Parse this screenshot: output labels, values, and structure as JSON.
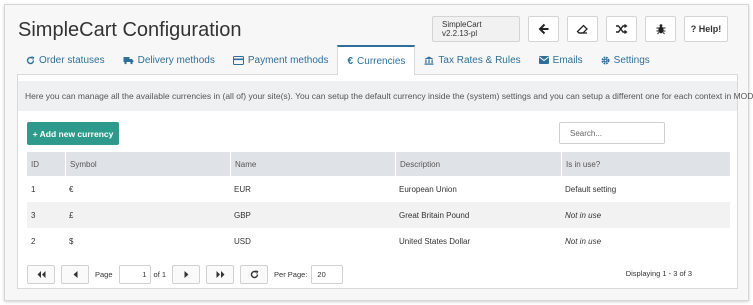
{
  "app": {
    "title": "SimpleCart Configuration"
  },
  "toolbar": {
    "version": "SimpleCart v2.2.13-pl",
    "buttons": [
      {
        "icon": "arrow-left-icon"
      },
      {
        "icon": "eraser-icon"
      },
      {
        "icon": "shuffle-icon"
      },
      {
        "icon": "bug-icon"
      }
    ],
    "help_label": "? Help!"
  },
  "tabs": [
    {
      "label": "Order statuses",
      "icon": "refresh-icon",
      "active": false
    },
    {
      "label": "Delivery methods",
      "icon": "truck-icon",
      "active": false
    },
    {
      "label": "Payment methods",
      "icon": "credit-card-icon",
      "active": false
    },
    {
      "label": "Currencies",
      "icon": "euro-icon",
      "active": true
    },
    {
      "label": "Tax Rates & Rules",
      "icon": "bank-icon",
      "active": false
    },
    {
      "label": "Emails",
      "icon": "envelope-icon",
      "active": false
    },
    {
      "label": "Settings",
      "icon": "gear-icon",
      "active": false
    }
  ],
  "info": "Here you can manage all the available currencies in (all of) your site(s). You can setup the default currency inside the (system) settings and you can setup a different one for each context in MODX.",
  "add_button": {
    "label": "+ Add new currency"
  },
  "search": {
    "placeholder": "Search..."
  },
  "table": {
    "columns": [
      "ID",
      "Symbol",
      "Name",
      "Description",
      "Is in use?"
    ],
    "rows": [
      {
        "id": "1",
        "symbol": "€",
        "name": "EUR",
        "description": "European Union",
        "in_use": "Default setting"
      },
      {
        "id": "3",
        "symbol": "£",
        "name": "GBP",
        "description": "Great Britain Pound",
        "in_use": "Not in use"
      },
      {
        "id": "2",
        "symbol": "$",
        "name": "USD",
        "description": "United States Dollar",
        "in_use": "Not in use"
      }
    ]
  },
  "pager": {
    "page_label": "Page",
    "page_value": "1",
    "of_label": "of 1",
    "per_page_label": "Per Page:",
    "per_page_value": "20",
    "displaying": "Displaying 1 - 3 of 3"
  },
  "colors": {
    "accent": "#2e9a8c",
    "link": "#2f6f9a",
    "header_bg": "#dfe3e7"
  }
}
